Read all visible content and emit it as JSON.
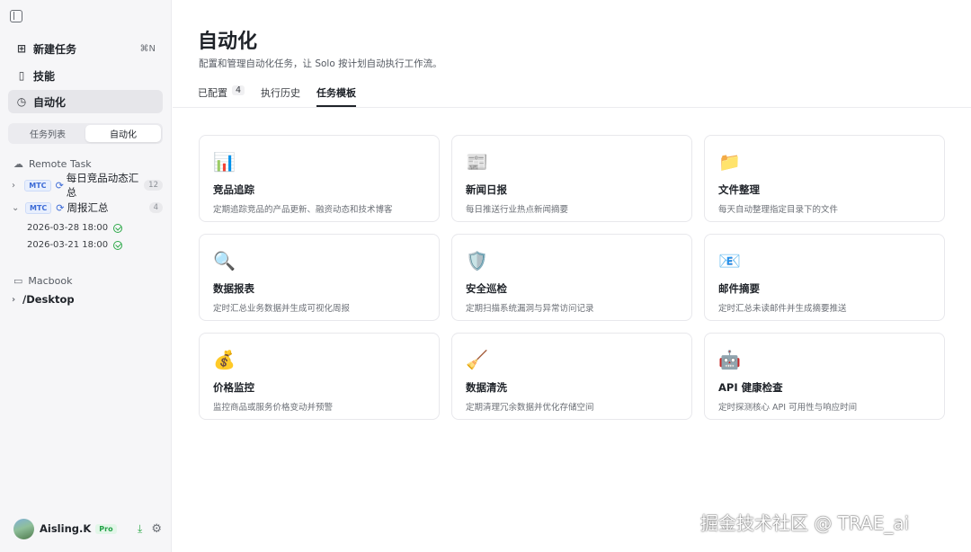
{
  "sidebar": {
    "nav": [
      {
        "label": "新建任务",
        "icon": "new-task-icon",
        "shortcut": "⌘N"
      },
      {
        "label": "技能",
        "icon": "book-icon",
        "shortcut": ""
      },
      {
        "label": "自动化",
        "icon": "timer-icon",
        "shortcut": ""
      }
    ],
    "segments": [
      "任务列表",
      "自动化"
    ],
    "remote_group": "Remote Task",
    "tasks": [
      {
        "tag": "MTC",
        "name": "每日竞品动态汇总",
        "count": "12"
      },
      {
        "tag": "MTC",
        "name": "周报汇总",
        "count": "4"
      }
    ],
    "runs": [
      "2026-03-28 18:00",
      "2026-03-21 18:00"
    ],
    "local_group": "Macbook",
    "folder": "/Desktop",
    "user": {
      "name": "Aisling.K",
      "plan": "Pro"
    }
  },
  "main": {
    "title": "自动化",
    "subtitle": "配置和管理自动化任务，让 Solo 按计划自动执行工作流。",
    "tabs": [
      {
        "label": "已配置",
        "badge": "4"
      },
      {
        "label": "执行历史",
        "badge": ""
      },
      {
        "label": "任务模板",
        "badge": ""
      }
    ],
    "templates": [
      {
        "icon": "📊",
        "icon_name": "chart-icon",
        "title": "竞品追踪",
        "desc": "定期追踪竞品的产品更新、融资动态和技术博客"
      },
      {
        "icon": "📰",
        "icon_name": "newspaper-icon",
        "title": "新闻日报",
        "desc": "每日推送行业热点新闻摘要"
      },
      {
        "icon": "📁",
        "icon_name": "folder-icon",
        "title": "文件整理",
        "desc": "每天自动整理指定目录下的文件"
      },
      {
        "icon": "🔍",
        "icon_name": "magnifier-icon",
        "title": "数据报表",
        "desc": "定时汇总业务数据并生成可视化周报"
      },
      {
        "icon": "🛡️",
        "icon_name": "shield-icon",
        "title": "安全巡检",
        "desc": "定期扫描系统漏洞与异常访问记录"
      },
      {
        "icon": "📧",
        "icon_name": "email-icon",
        "title": "邮件摘要",
        "desc": "定时汇总未读邮件并生成摘要推送"
      },
      {
        "icon": "💰",
        "icon_name": "money-bag-icon",
        "title": "价格监控",
        "desc": "监控商品或服务价格变动并预警"
      },
      {
        "icon": "🧹",
        "icon_name": "broom-icon",
        "title": "数据清洗",
        "desc": "定期清理冗余数据并优化存储空间"
      },
      {
        "icon": "🤖",
        "icon_name": "robot-icon",
        "title": "API 健康检查",
        "desc": "定时探测核心 API 可用性与响应时间"
      }
    ]
  },
  "watermark": "掘金技术社区 @ TRAE_ai"
}
